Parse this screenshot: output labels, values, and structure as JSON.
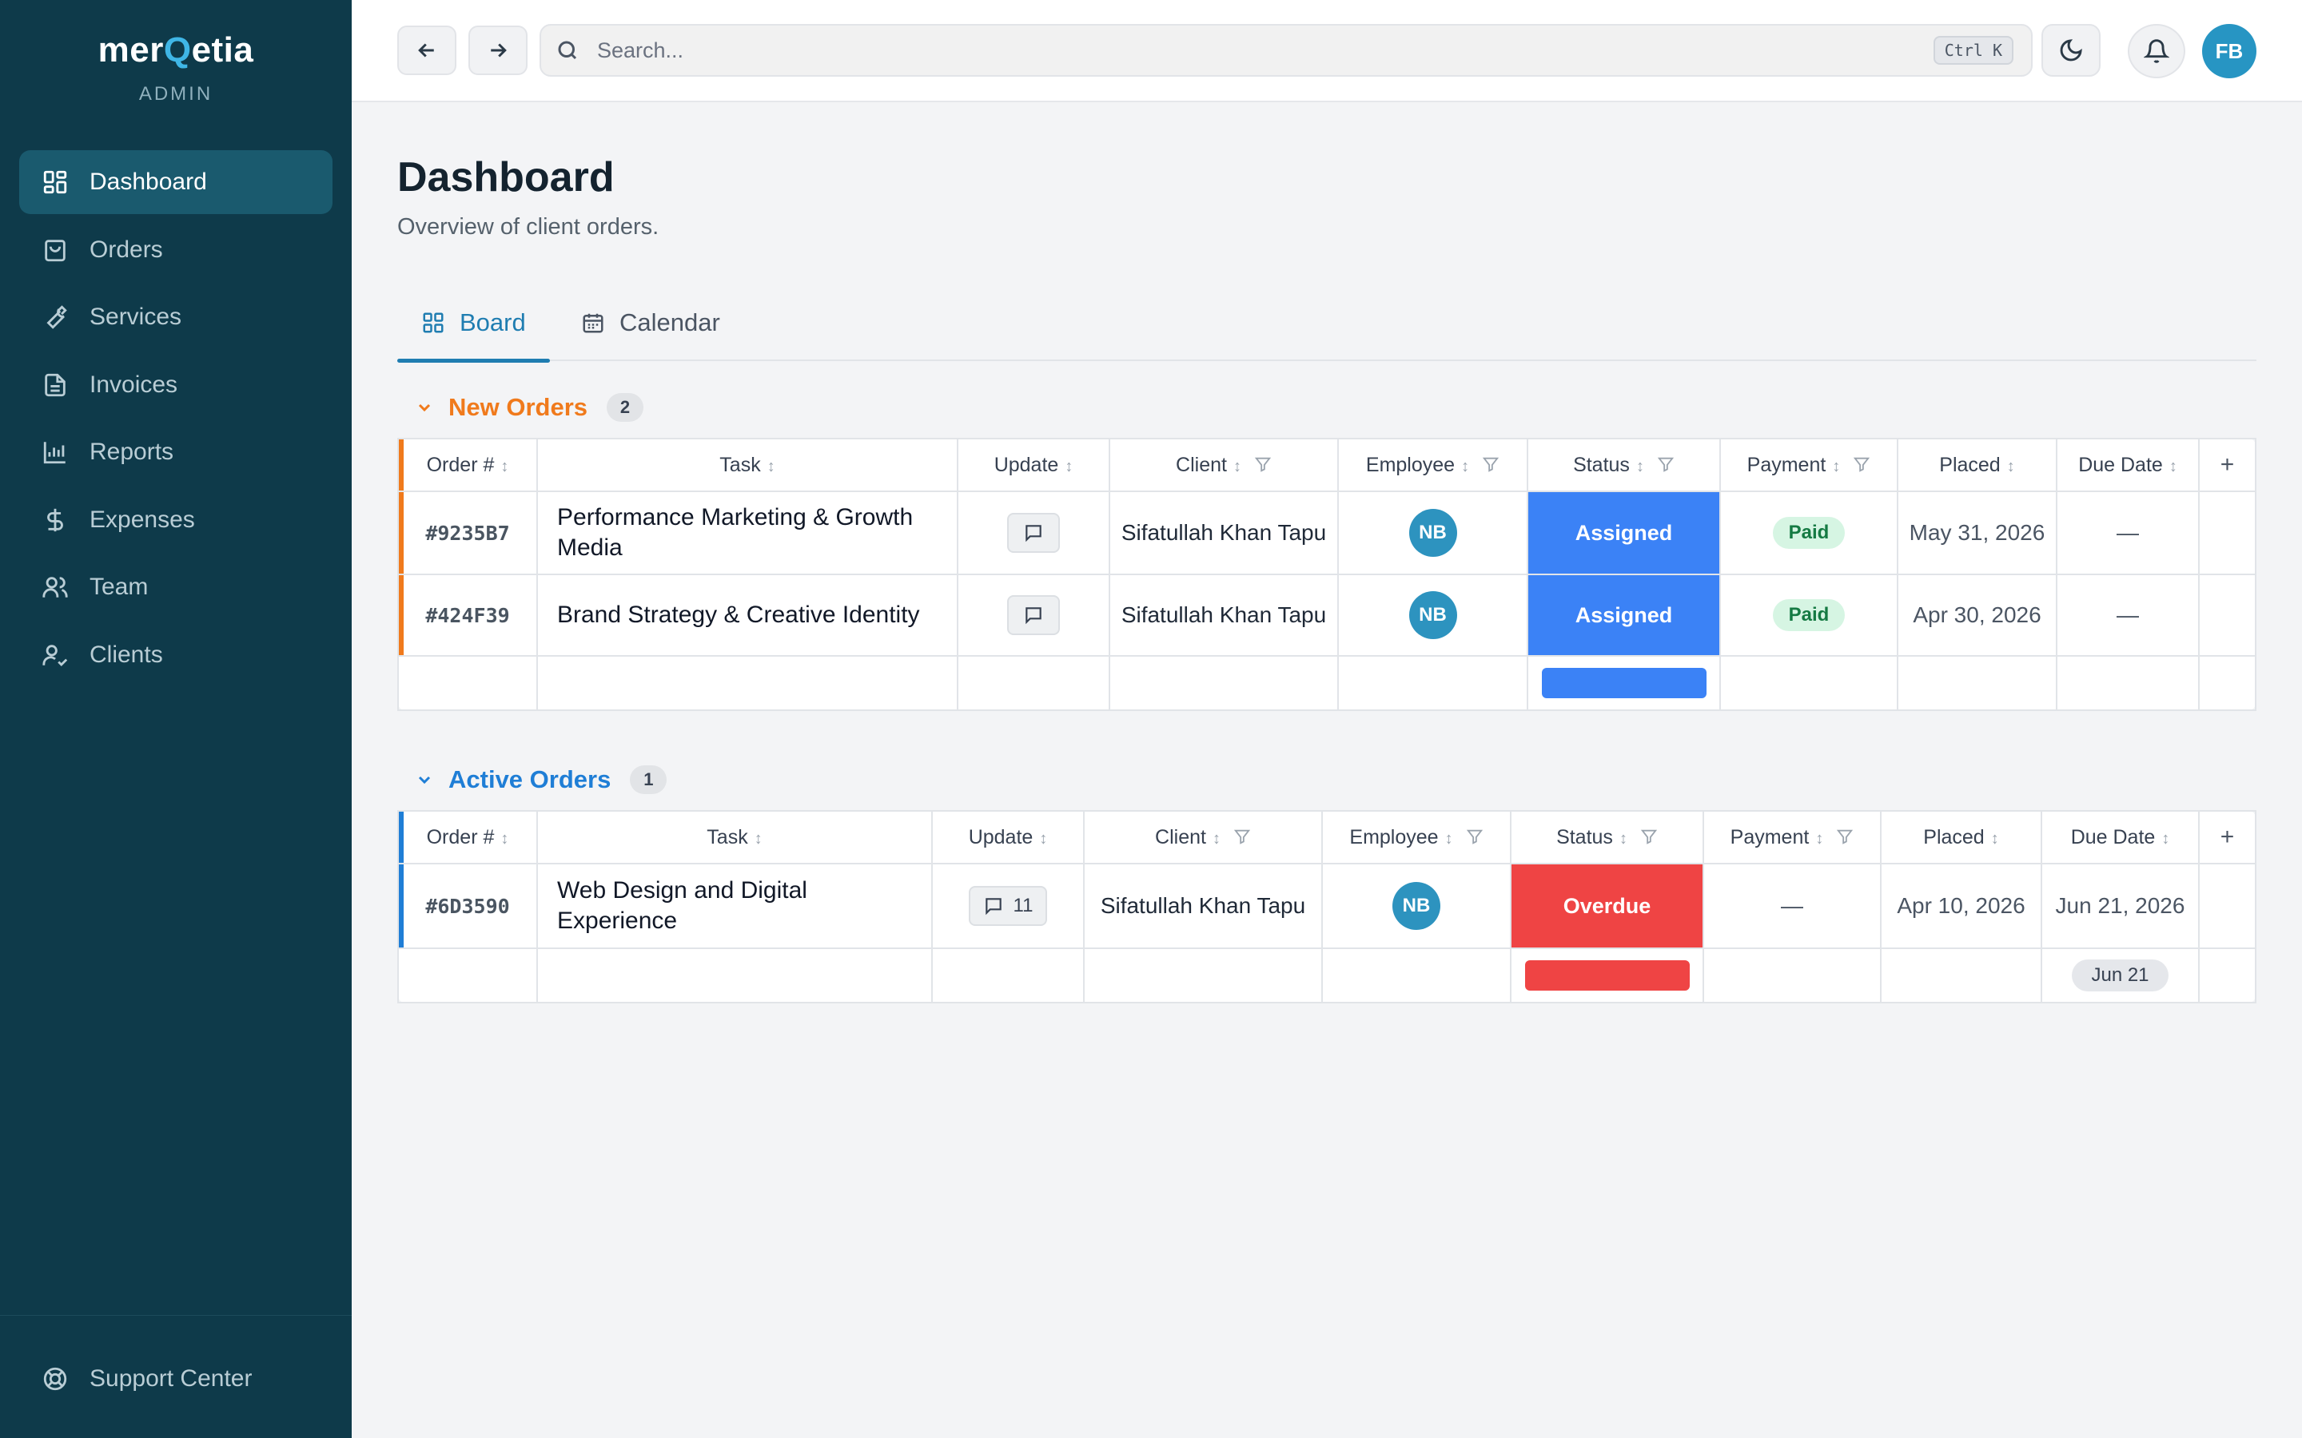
{
  "app": {
    "logo_pre": "mer",
    "logo_q": "Q",
    "logo_post": "etia",
    "subtitle": "ADMIN"
  },
  "sidebar": {
    "items": [
      {
        "label": "Dashboard",
        "icon": "grid-icon",
        "active": true
      },
      {
        "label": "Orders",
        "icon": "shopping-bag-icon"
      },
      {
        "label": "Services",
        "icon": "wrench-icon"
      },
      {
        "label": "Invoices",
        "icon": "file-icon"
      },
      {
        "label": "Reports",
        "icon": "bar-chart-icon"
      },
      {
        "label": "Expenses",
        "icon": "dollar-icon"
      },
      {
        "label": "Team",
        "icon": "users-icon"
      },
      {
        "label": "Clients",
        "icon": "user-check-icon"
      }
    ],
    "support": "Support Center"
  },
  "topbar": {
    "search_placeholder": "Search...",
    "shortcut": "Ctrl K",
    "avatar": "FB"
  },
  "page": {
    "title": "Dashboard",
    "subtitle": "Overview of client orders."
  },
  "tabs": [
    {
      "label": "Board",
      "active": true
    },
    {
      "label": "Calendar"
    }
  ],
  "columns": {
    "order": "Order #",
    "task": "Task",
    "update": "Update",
    "client": "Client",
    "employee": "Employee",
    "status": "Status",
    "payment": "Payment",
    "placed": "Placed",
    "due": "Due Date",
    "add": "+"
  },
  "groups": {
    "new": {
      "title": "New Orders",
      "count": "2",
      "color": "#f07a1c",
      "rows": [
        {
          "id": "#9235B7",
          "task": "Performance Marketing & Growth Media",
          "comments": "",
          "client": "Sifatullah Khan Tapu",
          "employee": "NB",
          "status": "Assigned",
          "payment": "Paid",
          "placed": "May 31, 2026",
          "due": "—"
        },
        {
          "id": "#424F39",
          "task": "Brand Strategy & Creative Identity",
          "comments": "",
          "client": "Sifatullah Khan Tapu",
          "employee": "NB",
          "status": "Assigned",
          "payment": "Paid",
          "placed": "Apr 30, 2026",
          "due": "—"
        }
      ]
    },
    "active": {
      "title": "Active Orders",
      "count": "1",
      "color": "#1f7ed6",
      "rows": [
        {
          "id": "#6D3590",
          "task": "Web Design and Digital Experience",
          "comments": "11",
          "client": "Sifatullah Khan Tapu",
          "employee": "NB",
          "status": "Overdue",
          "payment": "—",
          "placed": "Apr 10, 2026",
          "due": "Jun 21, 2026"
        }
      ],
      "summary_due": "Jun 21"
    }
  }
}
